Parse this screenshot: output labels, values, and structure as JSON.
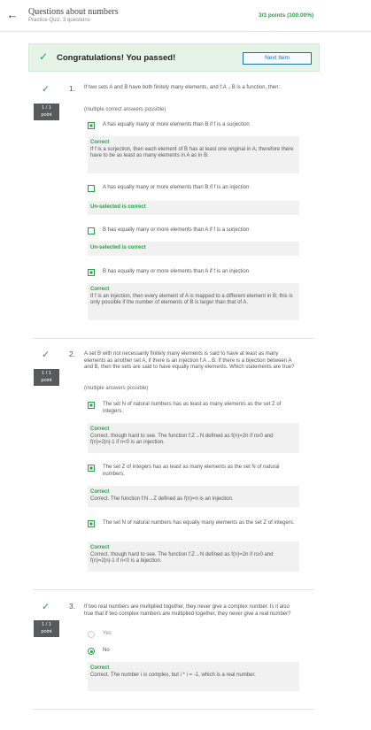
{
  "header": {
    "back_icon": "arrow-left-icon",
    "title": "Questions about numbers",
    "subtitle": "Practice Quiz, 3 questions",
    "points": "3/3 points (100.00%)"
  },
  "banner": {
    "message": "Congratulations! You passed!",
    "next_label": "Next Item",
    "check_icon": "check-icon"
  },
  "questions": [
    {
      "number": "1.",
      "score_top": "1 / 1",
      "score_bottom": "point",
      "text": "If two sets A and B have both finitely many elements, and f:A→B is a function, then:",
      "note": "(multiple correct answers possible)",
      "options": [
        {
          "label": "A has equally many or more elements than B if f is a surjection",
          "checked": true,
          "feedback_head": "Correct",
          "feedback_body": "If f is a surjection, then each element of B has at least one original in A; therefore there have to be as least as many elements in A as in B."
        },
        {
          "label": "A has equally many or more elements than B if f is an injection",
          "checked": false,
          "feedback_head": "Un-selected is correct",
          "feedback_body": ""
        },
        {
          "label": "B has equally many or more elements than A if f is a surjection",
          "checked": false,
          "feedback_head": "Un-selected is correct",
          "feedback_body": ""
        },
        {
          "label": "B has equally many or more elements than A if f is an injection",
          "checked": true,
          "feedback_head": "Correct",
          "feedback_body": "If f is an injection, then every element of A is mapped to a different element in B; this is only possible if the number of elements of B is larger than that of A."
        }
      ]
    },
    {
      "number": "2.",
      "score_top": "1 / 1",
      "score_bottom": "point",
      "text": "A set B with not necessarily finitely many elements is said to have at least as many elements as another set A, if there is an injection f:A→B. If there is a bijection between A and B, then the sets are said to have equally many elements. Which statements are true?",
      "note": "(multiple answers possible)",
      "options": [
        {
          "label": "The set N of natural numbers has as least as many elements as the set Z of integers.",
          "checked": true,
          "feedback_head": "Correct",
          "feedback_body": "Correct, though hard to see. The function f:Z→N defined as f(n)=2n if n≥0 and f(n)=2|n|-1 if n<0 is an injection."
        },
        {
          "label": "The set Z of integers has as least as many elements as the set N of natural numbers.",
          "checked": true,
          "feedback_head": "Correct",
          "feedback_body": "Correct. The function f:N→Z defined as f(n)=n is an injection."
        },
        {
          "label": "The set N of natural numbers has equally many elements as the set Z of integers.",
          "checked": true,
          "feedback_head": "Correct",
          "feedback_body": "Correct, though hard to see. The function f:Z→N defined as f(n)=2n if n≥0 and f(n)=2|n|-1 if n<0 is a bijection."
        }
      ]
    },
    {
      "number": "3.",
      "score_top": "1 / 1",
      "score_bottom": "point",
      "text": "If two real numbers are multiplied together, they never give a complex number. Is it also true that if two complex numbers are multiplied together, they never give a real number?",
      "options": [
        {
          "label": "Yes",
          "selected": false
        },
        {
          "label": "No",
          "selected": true,
          "feedback_head": "Correct",
          "feedback_body": "Correct. The number i is complex, but i * i = -1, which is a real number."
        }
      ]
    }
  ]
}
